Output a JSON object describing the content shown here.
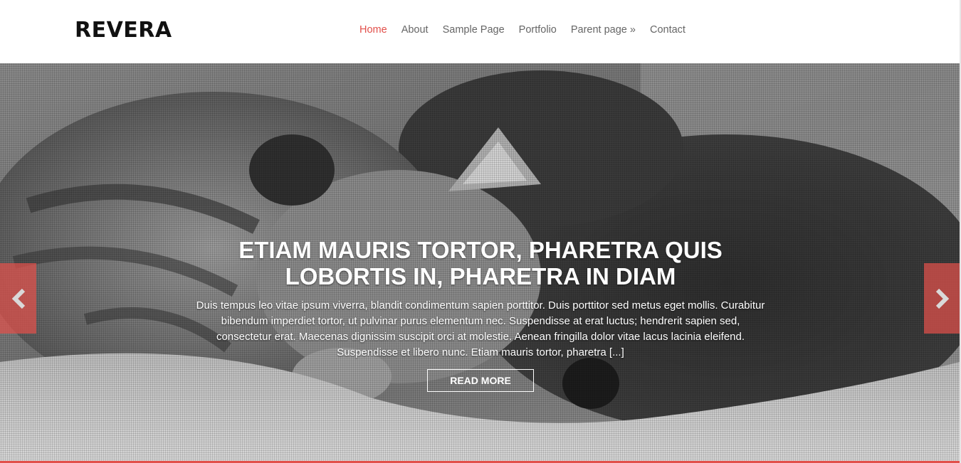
{
  "site": {
    "logo": "REVERA"
  },
  "nav": {
    "items": [
      {
        "label": "Home",
        "active": true
      },
      {
        "label": "About"
      },
      {
        "label": "Sample Page"
      },
      {
        "label": "Portfolio"
      },
      {
        "label": "Parent page »"
      },
      {
        "label": "Contact"
      }
    ]
  },
  "slider": {
    "title": "ETIAM MAURIS TORTOR, PHARETRA QUIS LOBORTIS IN, PHARETRA IN DIAM",
    "excerpt": "Duis tempus leo vitae ipsum viverra, blandit condimentum sapien porttitor. Duis porttitor sed metus eget mollis. Curabitur bibendum imperdiet tortor, ut pulvinar purus elementum nec. Suspendisse at erat luctus; hendrerit sapien sed, consectetur erat. Maecenas dignissim suscipit orci at molestie. Aenean fringilla dolor vitae lacus lacinia eleifend. Suspendisse et libero nunc. Etiam mauris tortor, pharetra [...]",
    "button_label": "READ MORE",
    "prev_icon": "chevron-left-icon",
    "next_icon": "chevron-right-icon"
  },
  "colors": {
    "accent": "#e2504b",
    "nav_text": "#666666",
    "logo": "#111111"
  }
}
